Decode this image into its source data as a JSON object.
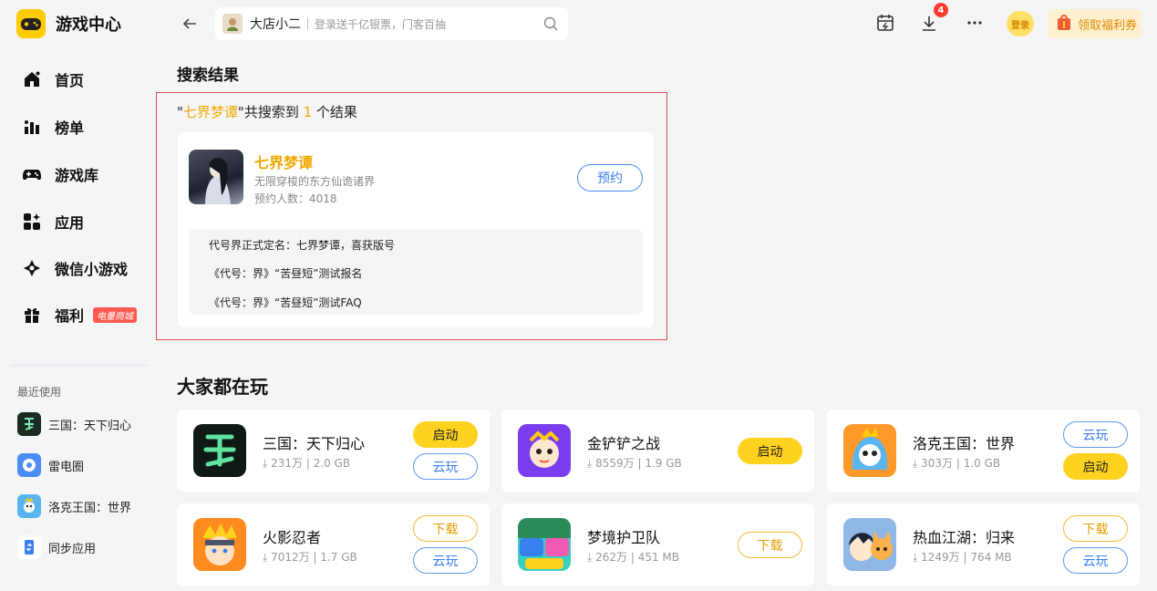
{
  "app": {
    "title": "游戏中心"
  },
  "nav": [
    {
      "label": "首页",
      "icon": "home-icon"
    },
    {
      "label": "榜单",
      "icon": "ranking-icon"
    },
    {
      "label": "游戏库",
      "icon": "gamepad-icon"
    },
    {
      "label": "应用",
      "icon": "apps-icon"
    },
    {
      "label": "微信小游戏",
      "icon": "mini-game-icon"
    },
    {
      "label": "福利",
      "icon": "gift-icon",
      "badge": "电量商城"
    }
  ],
  "recent": {
    "title": "最近使用",
    "items": [
      {
        "label": "三国：天下归心"
      },
      {
        "label": "雷电圈"
      },
      {
        "label": "洛克王国：世界"
      },
      {
        "label": "同步应用"
      }
    ]
  },
  "search": {
    "value": "大店小二",
    "placeholder": "登录送千亿银票，门客百抽"
  },
  "header": {
    "download_count": "4",
    "login_label": "登录",
    "coupon_label": "领取福利券"
  },
  "results": {
    "title": "搜索结果",
    "summary": {
      "q_open": "\"",
      "query": "七界梦谭",
      "q_close": "\"",
      "prefix": "共搜索到 ",
      "count": "1",
      "suffix": " 个结果"
    },
    "game": {
      "name": "七界梦谭",
      "desc": "无限穿梭的东方仙诡诸界",
      "count": "预约人数：4018",
      "action": "预约",
      "news": [
        "代号界正式定名：七界梦谭，喜获版号",
        "《代号：界》“苦昼短”测试报名",
        "《代号：界》“苦昼短”测试FAQ"
      ]
    }
  },
  "popular": {
    "title": "大家都在玩",
    "items": [
      {
        "name": "三国：天下归心",
        "size": "231万",
        "volume": "2.0 GB",
        "buttons": [
          "启动",
          "云玩"
        ]
      },
      {
        "name": "金铲铲之战",
        "size": "8559万",
        "volume": "1.9 GB",
        "buttons": [
          "启动"
        ]
      },
      {
        "name": "洛克王国：世界",
        "size": "303万",
        "volume": "1.0 GB",
        "buttons": [
          "云玩",
          "启动"
        ]
      },
      {
        "name": "火影忍者",
        "size": "7012万",
        "volume": "1.7 GB",
        "buttons": [
          "下载",
          "云玩"
        ]
      },
      {
        "name": "梦境护卫队",
        "size": "262万",
        "volume": "451 MB",
        "buttons": [
          "下载"
        ]
      },
      {
        "name": "热血江湖：归来",
        "size": "1249万",
        "volume": "764 MB",
        "buttons": [
          "下载",
          "云玩"
        ]
      }
    ]
  },
  "colors": {
    "accent": "#ffcc00",
    "highlight": "#f0a800",
    "blue": "#3a7ff0",
    "red_border": "#e24c4c"
  }
}
